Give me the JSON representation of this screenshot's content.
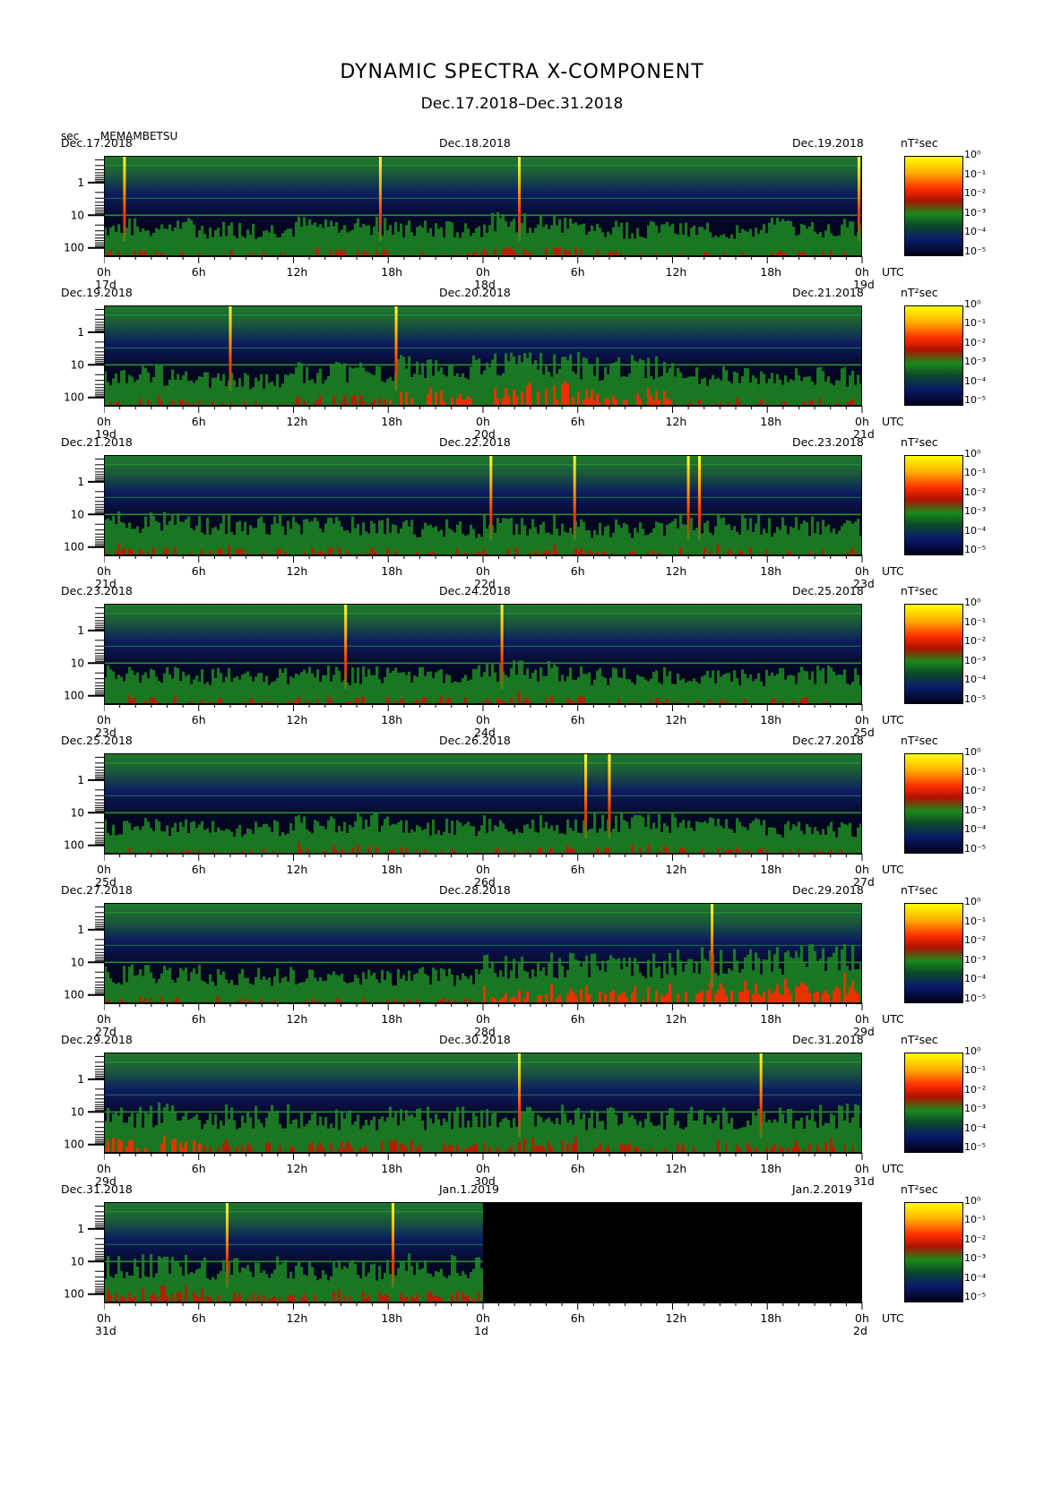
{
  "header": {
    "title": "DYNAMIC SPECTRA X-COMPONENT",
    "subtitle": "Dec.17.2018–Dec.31.2018",
    "y_unit": "sec",
    "station": "MEMAMBETSU"
  },
  "colorbar": {
    "unit": "nT²sec",
    "ticks": [
      "10⁰",
      "10⁻¹",
      "10⁻²",
      "10⁻³",
      "10⁻⁴",
      "10⁻⁵"
    ]
  },
  "time_axis": {
    "ticks": [
      "0h",
      "6h",
      "12h",
      "18h",
      "0h",
      "6h",
      "12h",
      "18h",
      "0h"
    ],
    "utc_label": "UTC"
  },
  "panels": [
    {
      "start_date": "Dec.17.2018",
      "mid_date": "Dec.18.2018",
      "end_date": "Dec.19.2018",
      "day_start": "17d",
      "day_mid": "18d",
      "day_end": "19d"
    },
    {
      "start_date": "Dec.19.2018",
      "mid_date": "Dec.20.2018",
      "end_date": "Dec.21.2018",
      "day_start": "19d",
      "day_mid": "20d",
      "day_end": "21d"
    },
    {
      "start_date": "Dec.21.2018",
      "mid_date": "Dec.22.2018",
      "end_date": "Dec.23.2018",
      "day_start": "21d",
      "day_mid": "22d",
      "day_end": "23d"
    },
    {
      "start_date": "Dec.23.2018",
      "mid_date": "Dec.24.2018",
      "end_date": "Dec.25.2018",
      "day_start": "23d",
      "day_mid": "24d",
      "day_end": "25d"
    },
    {
      "start_date": "Dec.25.2018",
      "mid_date": "Dec.26.2018",
      "end_date": "Dec.27.2018",
      "day_start": "25d",
      "day_mid": "26d",
      "day_end": "27d"
    },
    {
      "start_date": "Dec.27.2018",
      "mid_date": "Dec.28.2018",
      "end_date": "Dec.29.2018",
      "day_start": "27d",
      "day_mid": "28d",
      "day_end": "29d"
    },
    {
      "start_date": "Dec.29.2018",
      "mid_date": "Dec.30.2018",
      "end_date": "Dec.31.2018",
      "day_start": "29d",
      "day_mid": "30d",
      "day_end": "31d"
    },
    {
      "start_date": "Dec.31.2018",
      "mid_date": "Jan.1.2019",
      "end_date": "Jan.2.2019",
      "day_start": "31d",
      "day_mid": "1d",
      "day_end": "2d"
    }
  ],
  "chart_data": {
    "type": "heatmap",
    "title": "DYNAMIC SPECTRA X-COMPONENT",
    "subtitle": "Dec.17.2018–Dec.31.2018",
    "ylabel": "sec",
    "y_scale": "log",
    "y_ticks": [
      1,
      10,
      100
    ],
    "y_tick_labels": [
      "1",
      "10",
      "100"
    ],
    "x_hours_range": [
      0,
      48
    ],
    "x_tick_hours": [
      0,
      6,
      12,
      18,
      24,
      30,
      36,
      42,
      48
    ],
    "colorbar_unit": "nT²sec",
    "colorbar_range": [
      1e-05,
      1
    ],
    "colors": {
      "high": "#ffff00",
      "mid_high": "#ff3000",
      "mid": "#1a8a1a",
      "low": "#0a1a6a",
      "none": "#000000"
    },
    "spikes_hours": [
      [
        1.3,
        17.5,
        26.3,
        47.8
      ],
      [
        8,
        18.5
      ],
      [
        24.5,
        29.8,
        37,
        37.7
      ],
      [
        15.3,
        25.2
      ],
      [
        30.5,
        32
      ],
      [
        38.5
      ],
      [
        26.3,
        41.6
      ],
      [
        7.8,
        18.3
      ]
    ],
    "activity_level": [
      [
        0.35,
        0.3,
        0.4,
        0.3,
        0.45,
        0.3,
        0.25,
        0.35
      ],
      [
        0.4,
        0.25,
        0.45,
        0.6,
        0.75,
        0.6,
        0.4,
        0.35
      ],
      [
        0.45,
        0.4,
        0.35,
        0.3,
        0.4,
        0.3,
        0.4,
        0.35
      ],
      [
        0.35,
        0.3,
        0.35,
        0.35,
        0.45,
        0.35,
        0.3,
        0.35
      ],
      [
        0.3,
        0.25,
        0.4,
        0.3,
        0.35,
        0.4,
        0.3,
        0.25
      ],
      [
        0.35,
        0.3,
        0.25,
        0.3,
        0.6,
        0.6,
        0.7,
        0.75
      ],
      [
        0.6,
        0.55,
        0.5,
        0.5,
        0.55,
        0.5,
        0.5,
        0.55
      ],
      [
        0.55,
        0.5,
        0.45,
        0.55
      ]
    ],
    "data_gap_hours": [
      [
        24,
        48
      ]
    ]
  }
}
